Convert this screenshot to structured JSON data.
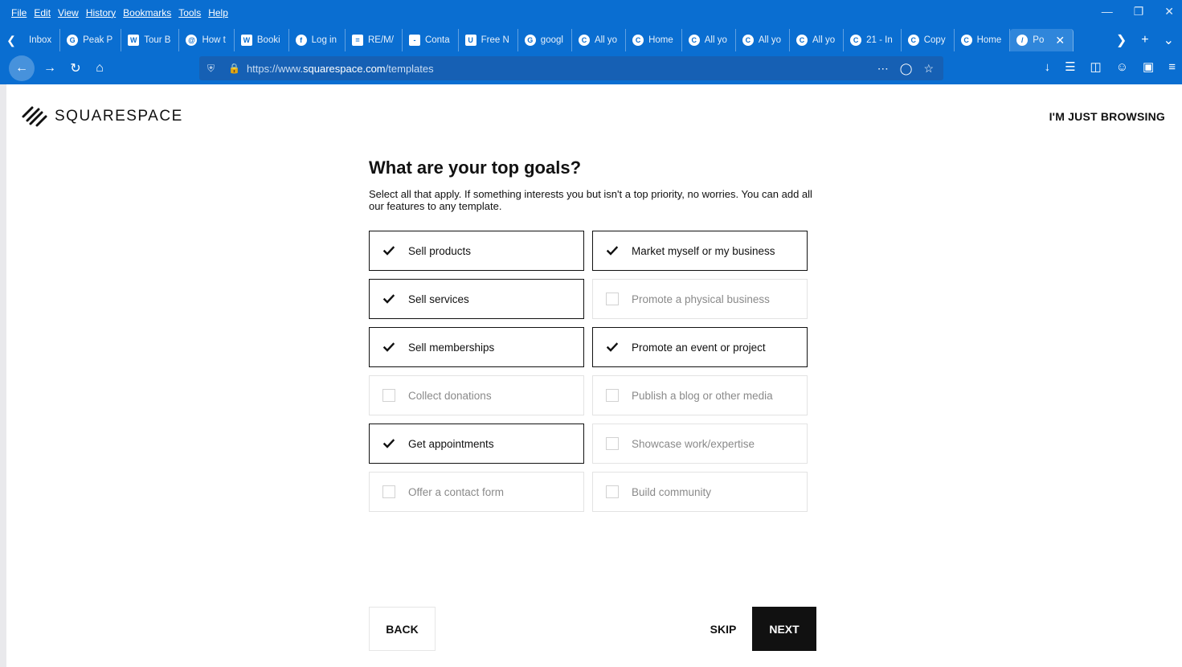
{
  "browser": {
    "menu": [
      "File",
      "Edit",
      "View",
      "History",
      "Bookmarks",
      "Tools",
      "Help"
    ],
    "tabs": [
      {
        "title": "Inbox",
        "icon": "mail"
      },
      {
        "title": "Peak P",
        "icon": "G"
      },
      {
        "title": "Tour B",
        "icon": "W"
      },
      {
        "title": "How t",
        "icon": "swirl"
      },
      {
        "title": "Booki",
        "icon": "W"
      },
      {
        "title": "Log in",
        "icon": "f"
      },
      {
        "title": "RE/M/",
        "icon": "doc"
      },
      {
        "title": "Conta",
        "icon": "bar"
      },
      {
        "title": "Free N",
        "icon": "up"
      },
      {
        "title": "googl",
        "icon": "G"
      },
      {
        "title": "All yo",
        "icon": "C"
      },
      {
        "title": "Home",
        "icon": "C"
      },
      {
        "title": "All yo",
        "icon": "C"
      },
      {
        "title": "All yo",
        "icon": "C"
      },
      {
        "title": "All yo",
        "icon": "C"
      },
      {
        "title": "21 - In",
        "icon": "C"
      },
      {
        "title": "Copy",
        "icon": "C"
      },
      {
        "title": "Home",
        "icon": "C"
      },
      {
        "title": "Po",
        "icon": "squarespace",
        "active": true
      }
    ],
    "url_prefix": "https://www.",
    "url_host": "squarespace.com",
    "url_path": "/templates"
  },
  "page": {
    "logo_text": "SQUARESPACE",
    "browsing_link": "I'M JUST BROWSING",
    "heading": "What are your top goals?",
    "subtext": "Select all that apply. If something interests you but isn't a top priority, no worries. You can add all our features to any template.",
    "options": [
      {
        "label": "Sell products",
        "checked": true
      },
      {
        "label": "Market myself or my business",
        "checked": true
      },
      {
        "label": "Sell services",
        "checked": true
      },
      {
        "label": "Promote a physical business",
        "checked": false
      },
      {
        "label": "Sell memberships",
        "checked": true
      },
      {
        "label": "Promote an event or project",
        "checked": true
      },
      {
        "label": "Collect donations",
        "checked": false
      },
      {
        "label": "Publish a blog or other media",
        "checked": false
      },
      {
        "label": "Get appointments",
        "checked": true
      },
      {
        "label": "Showcase work/expertise",
        "checked": false
      },
      {
        "label": "Offer a contact form",
        "checked": false
      },
      {
        "label": "Build community",
        "checked": false
      }
    ],
    "back_label": "BACK",
    "skip_label": "SKIP",
    "next_label": "NEXT"
  },
  "colors": {
    "chrome": "#0a6ed1",
    "selected_border": "#111111",
    "unselected_border": "#e3e3e3",
    "next_bg": "#111111"
  }
}
